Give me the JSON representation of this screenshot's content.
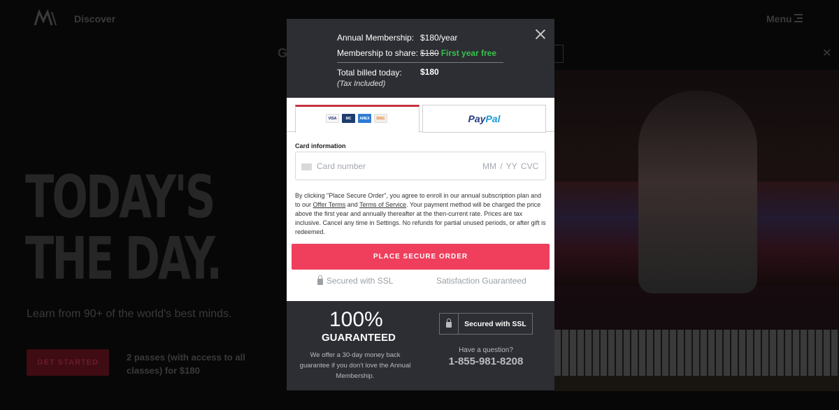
{
  "nav": {
    "discover": "Discover",
    "menu": "Menu"
  },
  "hero": {
    "title_line1": "TODAY'S",
    "title_line2": "THE DAY.",
    "subtitle": "Learn from 90+ of the world's best minds.",
    "cta": "GET STARTED",
    "passes_line1": "2 passes (with access to all",
    "passes_line2": "classes) for $180"
  },
  "banner": {
    "text": "G"
  },
  "summary": {
    "annual_label": "Annual Membership:",
    "annual_value": "$180/year",
    "share_label": "Membership to share:",
    "share_original": "$180",
    "share_free": "First year free",
    "billed_label": "Total billed today:",
    "billed_value": "$180",
    "tax_note": "(Tax Included)"
  },
  "payment": {
    "card_icons": [
      "VISA",
      "MC",
      "AMEX",
      "DISC"
    ],
    "paypal_part1": "Pay",
    "paypal_part2": "Pal",
    "card_info_label": "Card information",
    "card_number_placeholder": "Card number",
    "expiry_cvc_placeholder": "MM / YY  CVC",
    "terms_1": "By clicking \"Place Secure Order\", you agree to enroll in our annual subscription plan and to our ",
    "offer_terms": "Offer Terms",
    "terms_and": " and ",
    "terms_of_service": "Terms of Service",
    "terms_2": ". Your payment method will be charged the price above the first year and annually thereafter at the then-current rate. Prices are tax inclusive. Cancel any time in Settings. No refunds for partial unused periods, or after gift is redeemed.",
    "order_button": "PLACE SECURE ORDER",
    "secured_ssl": "Secured with SSL",
    "satisfaction": "Satisfaction Guaranteed"
  },
  "footer": {
    "percent": "100%",
    "guaranteed": "GUARANTEED",
    "money_back": "We offer a 30-day money back guarantee if you don't love the Annual Membership.",
    "ssl_badge": "Secured with SSL",
    "question": "Have a question?",
    "phone": "1-855-981-8208"
  },
  "colors": {
    "accent_red": "#ef3f5d",
    "free_green": "#36c24c",
    "modal_dark": "#2c2e33"
  }
}
